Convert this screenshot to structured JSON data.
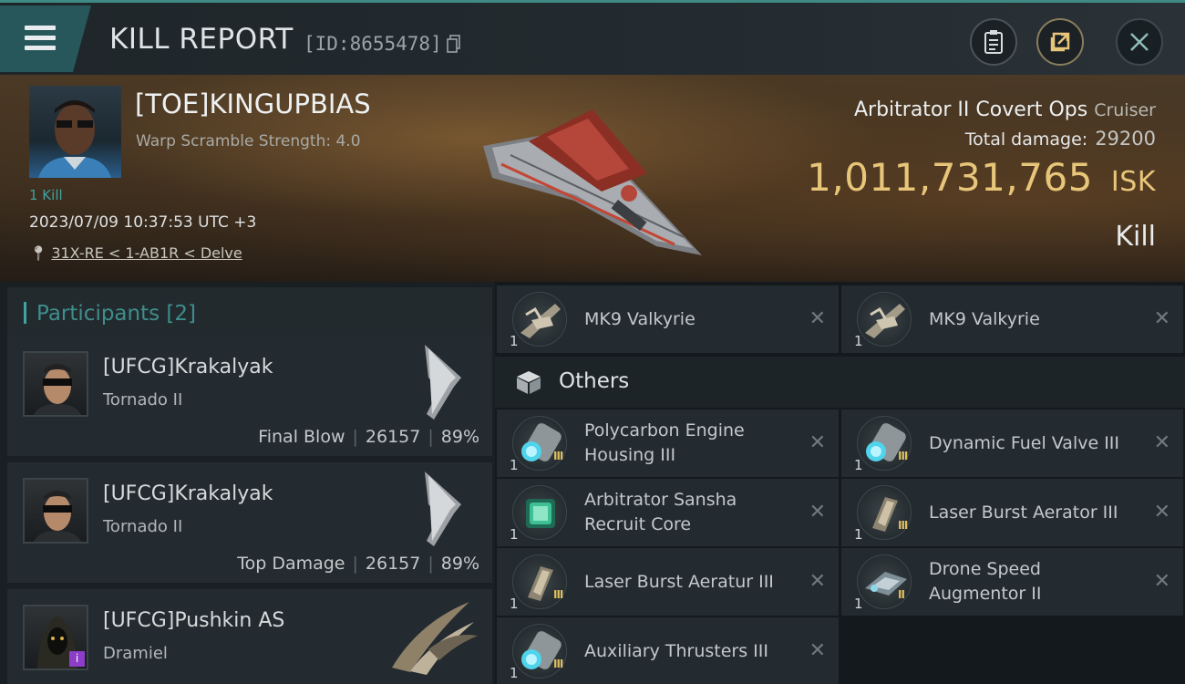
{
  "header": {
    "title": "KILL REPORT",
    "report_id": "[ID:8655478]"
  },
  "victim": {
    "name": "[TOE]KINGUPBIAS",
    "warp": "Warp Scramble Strength: 4.0",
    "kills": "1 Kill",
    "datetime": "2023/07/09 10:37:53 UTC +3",
    "location": "31X-RE < 1-AB1R < Delve",
    "ship_name": "Arbitrator II Covert Ops",
    "ship_class": "Cruiser",
    "damage_label": "Total damage:",
    "damage_value": "29200",
    "isk_value": "1,011,731,765",
    "isk_unit": "ISK",
    "result": "Kill"
  },
  "participants": {
    "title": "Participants [2]",
    "rows": [
      {
        "name": "[UFCG]Krakalyak",
        "ship": "Tornado II",
        "label": "Final Blow",
        "damage": "26157",
        "percent": "89%"
      },
      {
        "name": "[UFCG]Krakalyak",
        "ship": "Tornado II",
        "label": "Top Damage",
        "damage": "26157",
        "percent": "89%"
      },
      {
        "name": "[UFCG]Pushkin AS",
        "ship": "Dramiel",
        "badge": "i"
      }
    ]
  },
  "items": {
    "drones": [
      {
        "name": "MK9  Valkyrie",
        "qty": "1"
      },
      {
        "name": "MK9  Valkyrie",
        "qty": "1"
      }
    ],
    "others_title": "Others",
    "others": [
      {
        "name": "Polycarbon Engine Housing III",
        "qty": "1",
        "meta": "III"
      },
      {
        "name": "Dynamic Fuel Valve III",
        "qty": "1",
        "meta": "III"
      },
      {
        "name": "Arbitrator Sansha Recruit Core",
        "qty": "1",
        "meta": ""
      },
      {
        "name": "Laser Burst Aerator III",
        "qty": "1",
        "meta": "III"
      },
      {
        "name": "Laser Burst Aeratur III",
        "qty": "1",
        "meta": "III"
      },
      {
        "name": "Drone Speed Augmentor II",
        "qty": "1",
        "meta": "II"
      },
      {
        "name": "Auxiliary Thrusters III",
        "qty": "1",
        "meta": "III"
      }
    ],
    "remove_glyph": "✕"
  },
  "colors": {
    "accent": "#3fa3a0",
    "isk": "#e8c679",
    "badge": "#8c3ec8"
  }
}
